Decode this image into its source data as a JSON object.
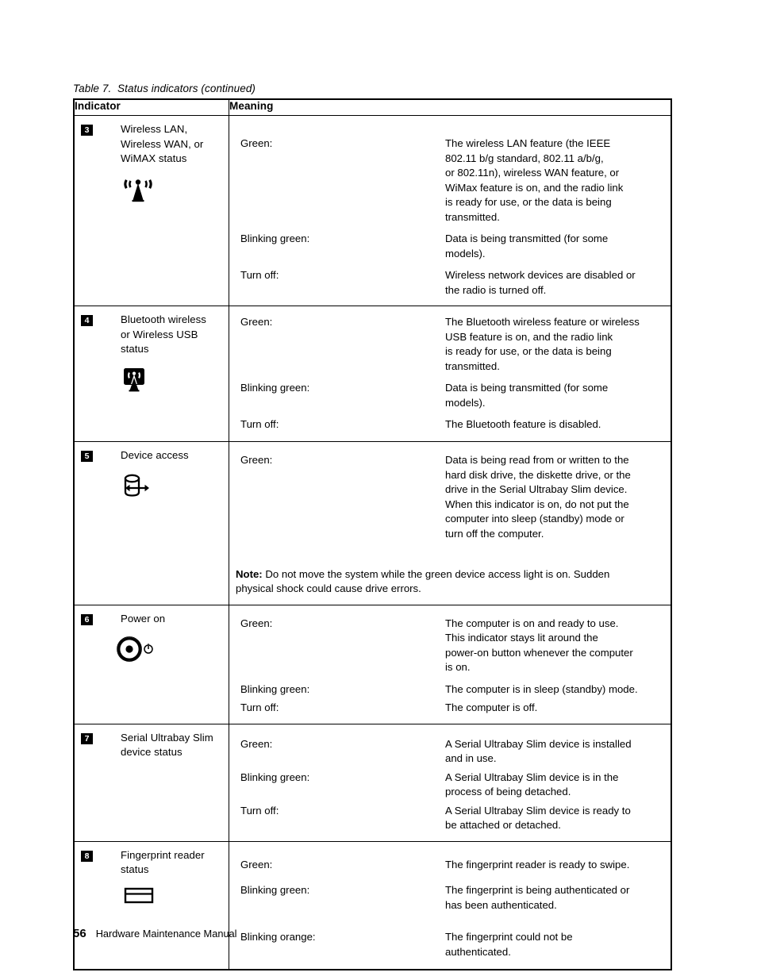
{
  "document": {
    "table_caption": "Table 7.  Status indicators (continued)",
    "footer": {
      "page_number": "56",
      "title": "Hardware Maintenance Manual"
    }
  },
  "table": {
    "headers": {
      "indicator": "Indicator",
      "meaning": "Meaning"
    },
    "rows": [
      {
        "badge": "3",
        "indicator_label": "Wireless  LAN,\nWireless WAN, or\nWiMAX status",
        "icon": "antenna-tower-icon",
        "meanings": [
          {
            "term": "Green:",
            "description": "The wireless LAN feature (the IEEE\n802.11 b/g standard, 802.11 a/b/g,\nor 802.11n), wireless WAN feature, or\nWiMax feature is on, and the radio link\nis ready for use, or the data is being\ntransmitted."
          },
          {
            "term": "Blinking green:",
            "description": "Data is being transmitted (for some\nmodels)."
          },
          {
            "term": "Turn off:",
            "description": "Wireless network devices are disabled or\nthe radio is turned off."
          }
        ]
      },
      {
        "badge": "4",
        "indicator_label": "Bluetooth wireless\nor  Wireless USB\nstatus",
        "icon": "bluetooth-wireless-usb-icon",
        "meanings": [
          {
            "term": "Green:",
            "description": "The Bluetooth wireless feature or wireless\nUSB feature is on, and the radio link\nis ready for use, or the data is being\ntransmitted."
          },
          {
            "term": "Blinking green:",
            "description": "Data is being transmitted (for some\nmodels)."
          },
          {
            "term": "Turn off:",
            "description": "The Bluetooth feature is disabled."
          }
        ]
      },
      {
        "badge": "5",
        "indicator_label": "Device access",
        "icon": "device-access-drive-icon",
        "meanings": [
          {
            "term": "Green:",
            "description": "Data is being read from or written to the\nhard disk drive, the diskette drive, or the\ndrive in the Serial Ultrabay Slim device.\nWhen this indicator is on, do not put the\ncomputer into sleep (standby) mode or\nturn off the computer."
          }
        ],
        "note_label": "Note:",
        "note_text": " Do not move the system while the green device access light is on.  Sudden\nphysical shock could cause drive errors."
      },
      {
        "badge": "6",
        "indicator_label": "Power on",
        "icon": "power-on-icon",
        "meanings": [
          {
            "term": "Green:",
            "description": "The computer is on and ready to use.\nThis indicator stays lit around the\npower-on button whenever the computer\nis on."
          },
          {
            "term": "Blinking green:",
            "description": "The computer is in sleep (standby) mode."
          },
          {
            "term": "Turn off:",
            "description": "The computer is off."
          }
        ]
      },
      {
        "badge": "7",
        "indicator_label": "Serial Ultrabay Slim\ndevice status",
        "icon": null,
        "meanings": [
          {
            "term": "Green:",
            "description": "A Serial Ultrabay Slim device is installed\nand in use."
          },
          {
            "term": "Blinking green:",
            "description": "A Serial Ultrabay Slim device is in the\nprocess of being detached."
          },
          {
            "term": "Turn off:",
            "description": "A Serial Ultrabay Slim device is ready to\nbe attached or detached."
          }
        ]
      },
      {
        "badge": "8",
        "indicator_label": "Fingerprint reader\nstatus",
        "icon": "fingerprint-reader-icon",
        "meanings": [
          {
            "term": "Green:",
            "description": "The fingerprint reader is ready to swipe."
          },
          {
            "term": "Blinking green:",
            "description": "The fingerprint is being authenticated or\nhas been authenticated."
          },
          {
            "term": "Blinking orange:",
            "description": "The  fingerprint  could  not  be\nauthenticated."
          }
        ]
      }
    ]
  }
}
